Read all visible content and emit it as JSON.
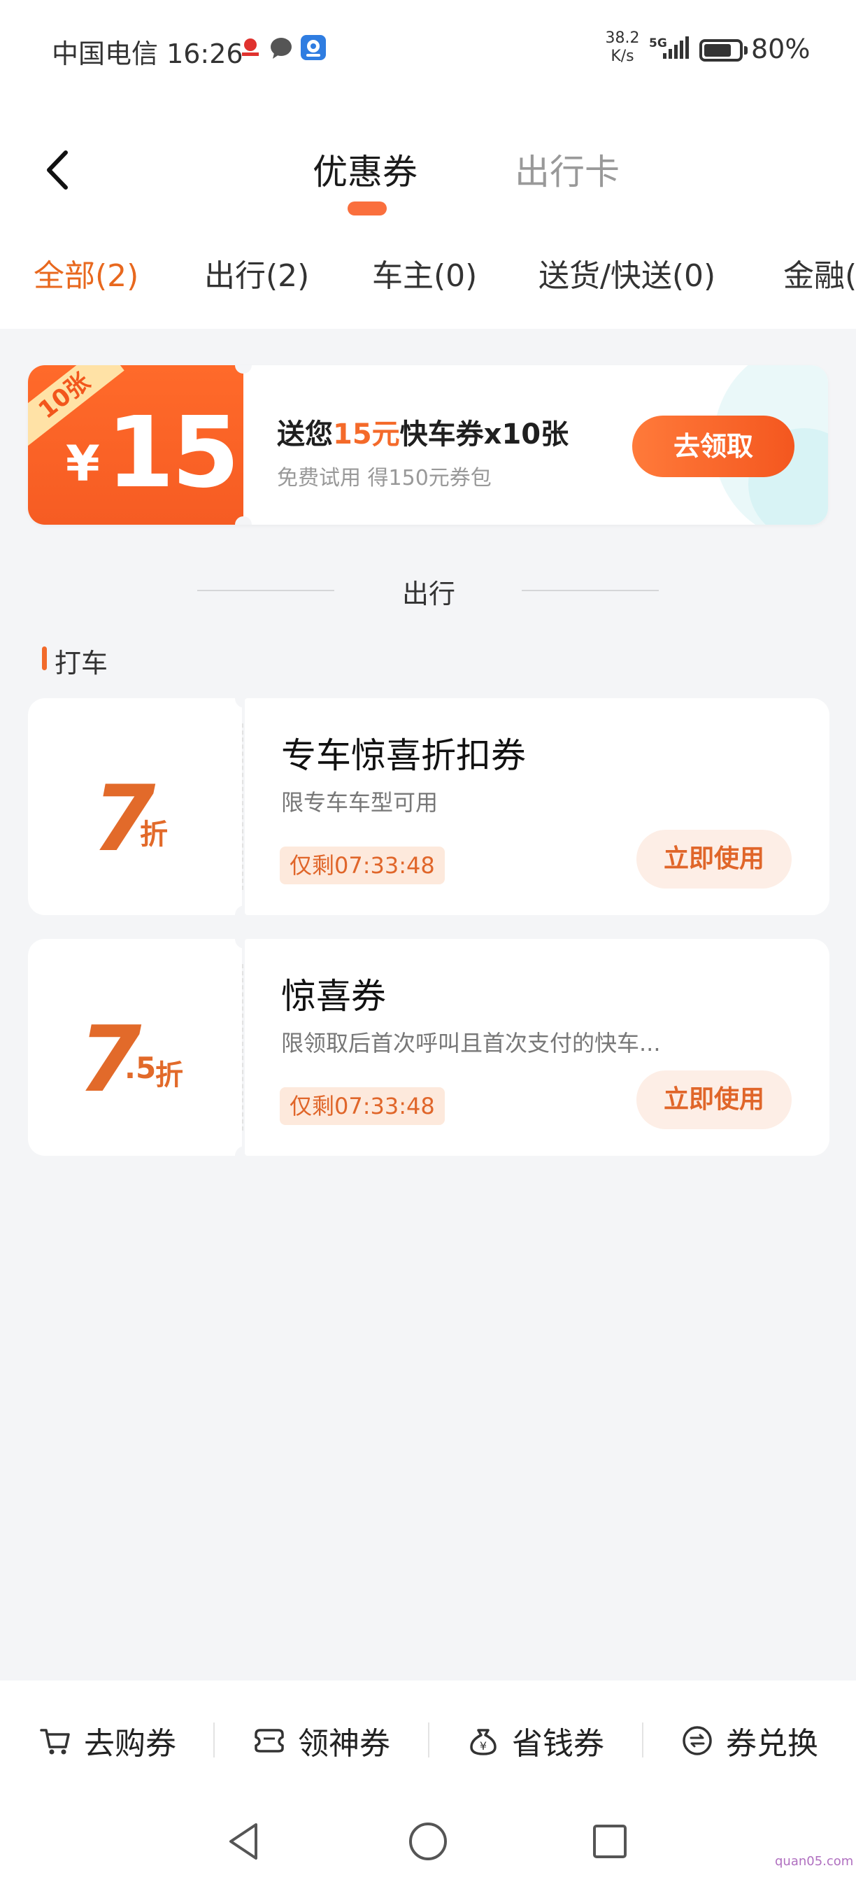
{
  "status_bar": {
    "carrier_time": "中国电信 16:26",
    "net_speed_value": "38.2",
    "net_speed_unit": "K/s",
    "signal_label": "5G",
    "battery": "80%",
    "battery_level": 0.8
  },
  "header": {
    "tabs": [
      {
        "label": "优惠券",
        "active": true
      },
      {
        "label": "出行卡",
        "active": false
      }
    ]
  },
  "filters": [
    {
      "label": "全部(2)",
      "active": true
    },
    {
      "label": "出行(2)",
      "active": false
    },
    {
      "label": "车主(0)",
      "active": false
    },
    {
      "label": "送货/快送(0)",
      "active": false
    },
    {
      "label": "金融(",
      "active": false
    }
  ],
  "banner": {
    "ribbon": "10张",
    "currency": "¥",
    "amount": "15",
    "title_prefix": "送您",
    "title_highlight": "15元",
    "title_suffix": "快车券x10张",
    "subtitle": "免费试用 得150元券包",
    "button": "去领取"
  },
  "section": {
    "label": "出行",
    "group": "打车"
  },
  "coupons": [
    {
      "discount_main": "7",
      "discount_decimal": "",
      "unit": "折",
      "title": "专车惊喜折扣券",
      "desc": "限专车车型可用",
      "timer": "仅剩07:33:48",
      "button": "立即使用"
    },
    {
      "discount_main": "7",
      "discount_decimal": ".5",
      "unit": "折",
      "title": "惊喜券",
      "desc": "限领取后首次呼叫且首次支付的快车...",
      "timer": "仅剩07:33:48",
      "button": "立即使用"
    }
  ],
  "bottom_nav": [
    {
      "label": "去购券",
      "icon": "cart-icon"
    },
    {
      "label": "领神券",
      "icon": "ticket-icon"
    },
    {
      "label": "省钱券",
      "icon": "money-bag-icon"
    },
    {
      "label": "券兑换",
      "icon": "exchange-icon"
    }
  ],
  "watermark": "quan05.com",
  "colors": {
    "accent": "#f46a2a",
    "accent_dark": "#e26a2a",
    "page_bg": "#f4f5f7"
  }
}
